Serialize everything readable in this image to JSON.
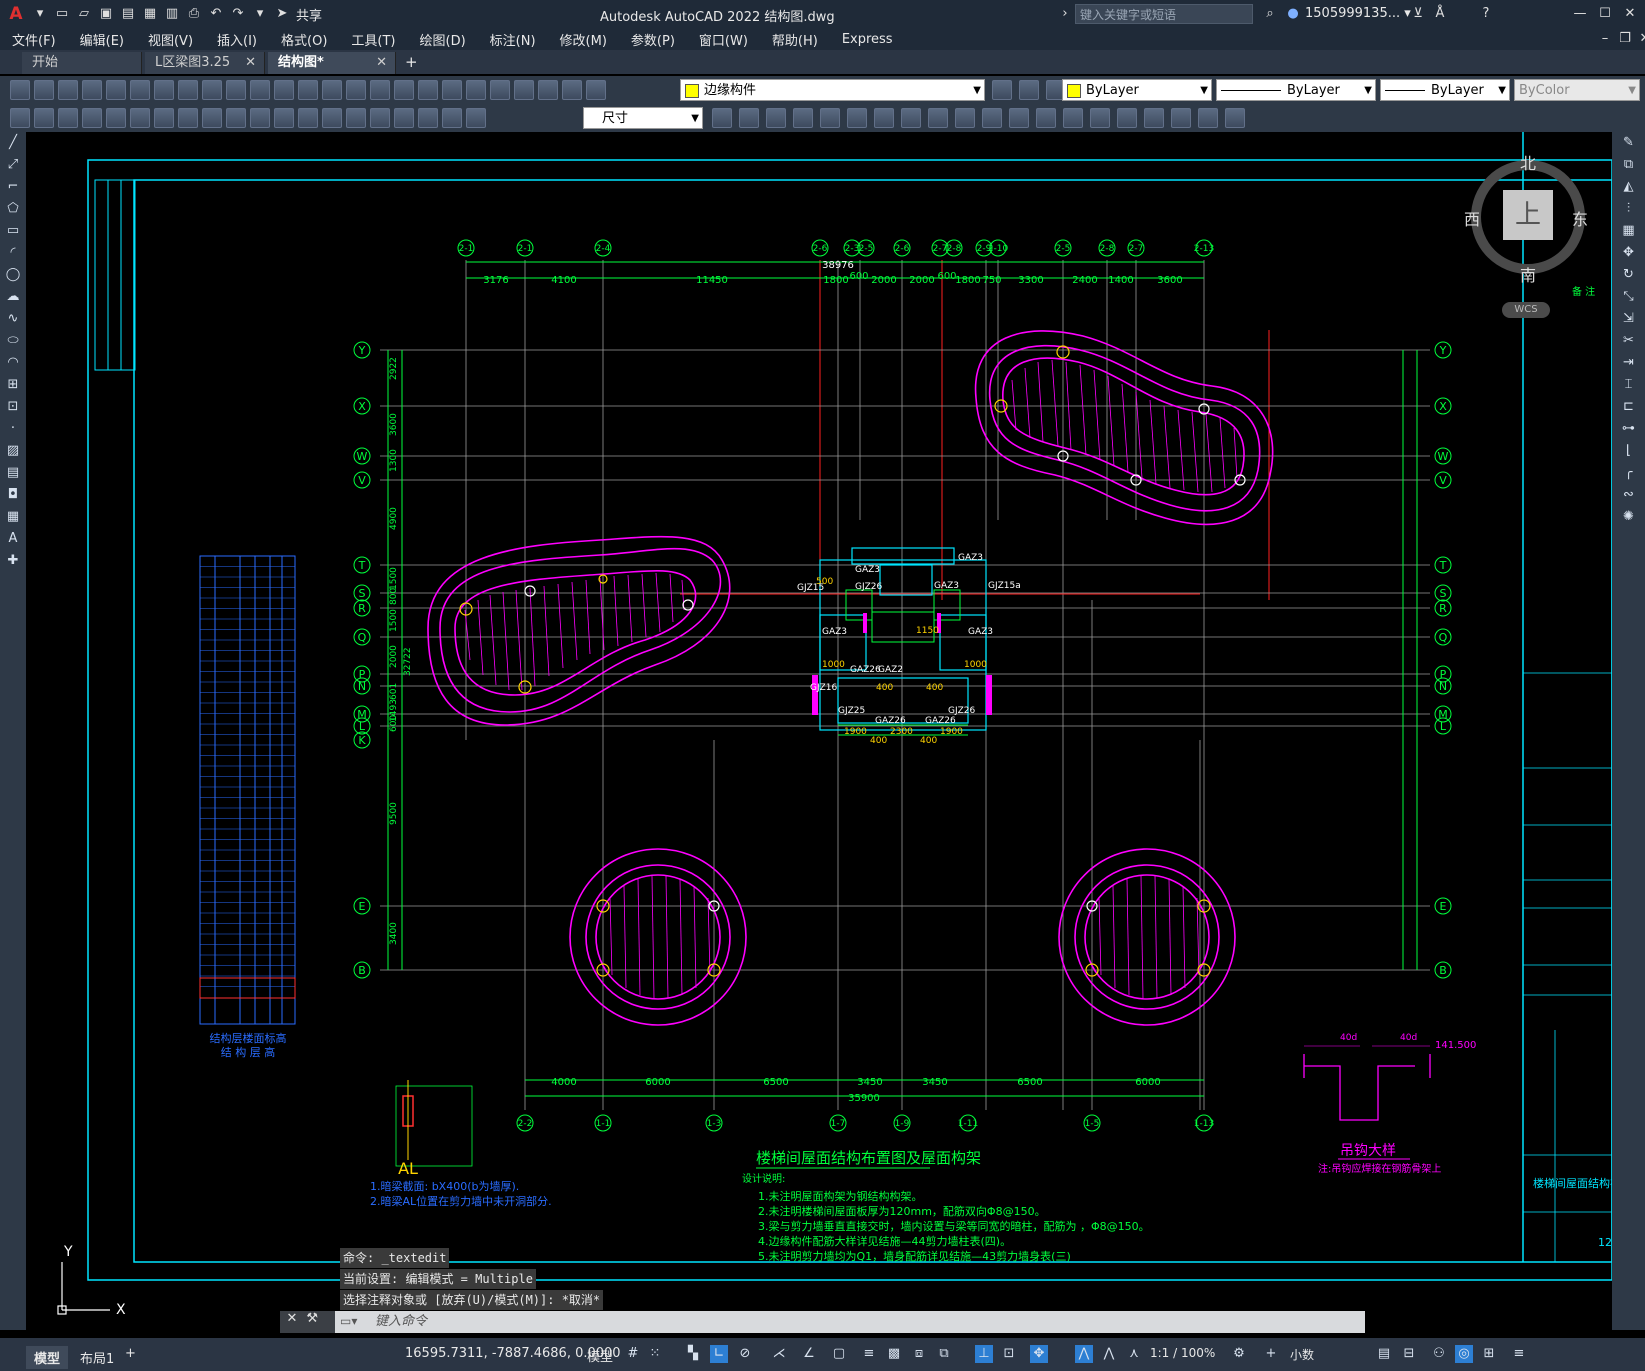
{
  "app": {
    "title": "Autodesk AutoCAD 2022    结构图.dwg",
    "share_label": "共享",
    "search_placeholder": "键入关键字或短语",
    "user": "1505999135... ▾"
  },
  "menu": [
    "文件(F)",
    "编辑(E)",
    "视图(V)",
    "插入(I)",
    "格式(O)",
    "工具(T)",
    "绘图(D)",
    "标注(N)",
    "修改(M)",
    "参数(P)",
    "窗口(W)",
    "帮助(H)",
    "Express"
  ],
  "tabs": [
    {
      "label": "开始"
    },
    {
      "label": "L区梁图3.25"
    },
    {
      "label": "结构图*"
    }
  ],
  "toolbar": {
    "layer": "边缘构件",
    "color": "ByLayer",
    "linetype": "ByLayer",
    "lineweight": "ByLayer",
    "plotstyle": "ByColor",
    "dimstyle": "尺寸"
  },
  "viewcube": {
    "north": "北",
    "south": "南",
    "east": "东",
    "west": "西",
    "top": "上",
    "wcs": "WCS"
  },
  "drawing": {
    "axes_top": [
      "2-1",
      "2-1",
      "2-4",
      "2-6",
      "2-3",
      "2-5",
      "2-6",
      "2-7",
      "2-8",
      "2-9",
      "2-10",
      "2-11",
      "2-5",
      "2-8",
      "2-7",
      "2-13"
    ],
    "axes_bottom": [
      "2-2",
      "1-1",
      "1-3",
      "1-7",
      "1-9",
      "1-11",
      "1-5",
      "1-13"
    ],
    "rows_left": [
      "Y",
      "X",
      "W",
      "V",
      "T",
      "S",
      "R",
      "Q",
      "P",
      "N",
      "M",
      "L",
      "K",
      "E",
      "B"
    ],
    "rows_right": [
      "Y",
      "X",
      "W",
      "V",
      "T",
      "S",
      "R",
      "Q",
      "P",
      "N",
      "M",
      "L",
      "E",
      "B"
    ],
    "dims_top_total": "38976",
    "dims_top": [
      "3176",
      "4100",
      "11450",
      "1800",
      "600",
      "2000",
      "2000",
      "600",
      "1800",
      "750",
      "3300",
      "2400",
      "1400",
      "3600"
    ],
    "dims_bottom": [
      "4000",
      "6000",
      "6500",
      "3450",
      "3450",
      "6500",
      "6000"
    ],
    "dims_bottom_total": "35900",
    "dims_left": [
      "2922",
      "3600",
      "1300",
      "4900",
      "1500",
      "800",
      "1500",
      "2000",
      "32722",
      "601",
      "1493",
      "600",
      "9500",
      "3400"
    ],
    "core_labels": [
      "GAZ3",
      "GJZ15",
      "GAZ3",
      "GJZ26",
      "GAZ3",
      "GJZ15a",
      "GAZ3",
      "GAZ3",
      "GAZ26",
      "GAZ2",
      "GJZ16",
      "GJZ25",
      "GAZ26",
      "GAZ26",
      "GJZ26"
    ],
    "core_dims": [
      "500",
      "1000",
      "1150",
      "1000",
      "400",
      "2300",
      "400",
      "1900",
      "1900",
      "400",
      "400"
    ],
    "title": "楼梯间屋面结构布置图及屋面构架",
    "notes_heading": "设计说明:",
    "notes": [
      "1.未注明屋面构架为钢结构构架。",
      "2.未注明楼梯间屋面板厚为120mm，配筋双向Φ8@150。",
      "3.梁与剪力墙垂直直接交时，墙内设置与梁等同宽的暗柱，配筋为        ，Φ8@150。",
      "4.边缘构件配筋大样详见结施—44剪力墙柱表(四)。",
      "5.未注明剪力墙均为Q1，墙身配筋详见结施—43剪力墙身表(三)"
    ],
    "al_notes": [
      "1.暗梁截面: bX400(b为墙厚).",
      "2.暗梁AL位置在剪力墙中未开洞部分."
    ],
    "al_label": "AL",
    "hook_label": "吊钩大样",
    "hook_note": "注:吊钩应焊接在钢筋骨架上",
    "hook_elev": "141.500",
    "hook_dim": "40d",
    "floor_table_title1": "结构层楼面标高",
    "floor_table_title2": "结 构 层 高",
    "titleblock_name": "楼梯间屋面结构布置图",
    "titleblock_no": "12",
    "remark": "备 注"
  },
  "command": {
    "history": [
      "命令: _textedit",
      "当前设置: 编辑模式 = Multiple",
      "选择注释对象或 [放弃(U)/模式(M)]: *取消*"
    ],
    "placeholder": "键入命令"
  },
  "status": {
    "layout_tabs": [
      "模型",
      "布局1"
    ],
    "coords": "16595.7311, -7887.4686, 0.0000",
    "model_label": "模型",
    "scale": "1:1 / 100%",
    "units": "小数"
  },
  "colors": {
    "titlebar": "#1f2a38",
    "grid_green": "#00ff3c",
    "border_cyan": "#00e5ff",
    "magenta": "#ff00ff",
    "red": "#ff2020",
    "grid_gray": "#9a9a9a"
  }
}
